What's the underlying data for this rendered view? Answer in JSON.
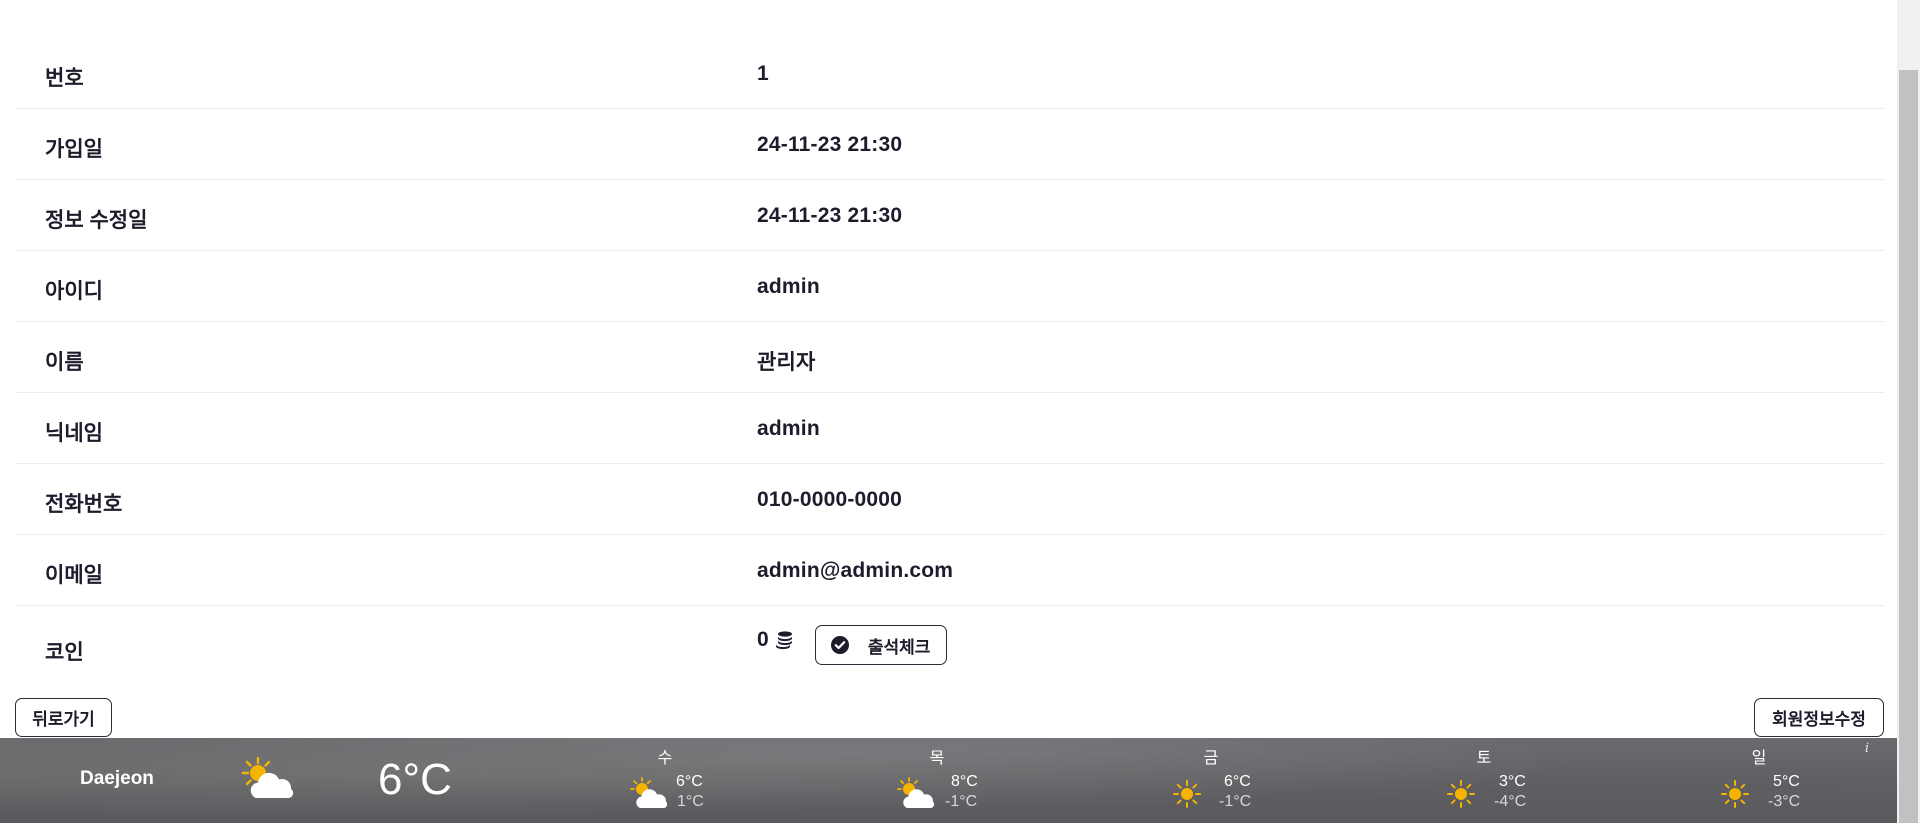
{
  "profile": {
    "rows": [
      {
        "label": "번호",
        "value": "1"
      },
      {
        "label": "가입일",
        "value": "24-11-23 21:30"
      },
      {
        "label": "정보 수정일",
        "value": "24-11-23 21:30"
      },
      {
        "label": "아이디",
        "value": "admin"
      },
      {
        "label": "이름",
        "value": "관리자"
      },
      {
        "label": "닉네임",
        "value": "admin"
      },
      {
        "label": "전화번호",
        "value": "010-0000-0000"
      },
      {
        "label": "이메일",
        "value": "admin@admin.com"
      }
    ],
    "coin": {
      "label": "코인",
      "value": "0",
      "icon": "coins-icon",
      "attendance_label": "출석체크"
    }
  },
  "actions": {
    "back_label": "뒤로가기",
    "edit_label": "회원정보수정"
  },
  "weather": {
    "city": "Daejeon",
    "current_temp": "6°C",
    "current_icon": "partly-cloudy-icon",
    "info_glyph": "i",
    "forecast": [
      {
        "day": "수",
        "hi": "6°C",
        "lo": "1°C",
        "icon": "partly-cloudy-icon"
      },
      {
        "day": "목",
        "hi": "8°C",
        "lo": "-1°C",
        "icon": "partly-cloudy-icon"
      },
      {
        "day": "금",
        "hi": "6°C",
        "lo": "-1°C",
        "icon": "sun-icon"
      },
      {
        "day": "토",
        "hi": "3°C",
        "lo": "-4°C",
        "icon": "sun-icon"
      },
      {
        "day": "일",
        "hi": "5°C",
        "lo": "-3°C",
        "icon": "sun-icon"
      }
    ]
  },
  "colors": {
    "text": "#1c1c2b",
    "sun": "#f5b400",
    "cloud": "#ffffff",
    "weather_bg": "#5e5e62"
  }
}
